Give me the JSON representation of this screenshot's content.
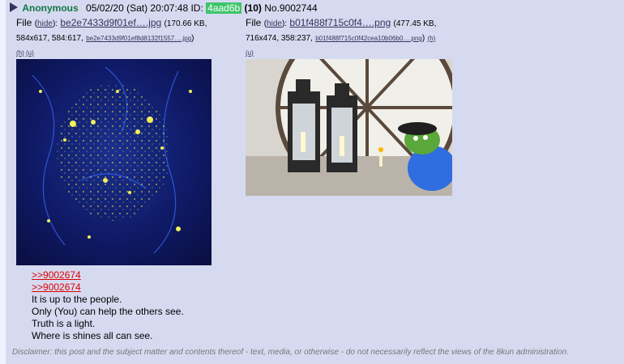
{
  "header": {
    "name": "Anonymous",
    "datetime": "05/02/20 (Sat) 20:07:48",
    "id_label": "ID:",
    "id_value": "4aad6b",
    "reply_count": "(10)",
    "post_number": "No.9002744"
  },
  "files": [
    {
      "prefix": "File",
      "hide_label": "hide",
      "name": "be2e7433d9f01ef….jpg",
      "size": "170.66 KB,",
      "dimensions": "584x617, 584:617,",
      "fullname": "be2e7433d9f01ef8d8132f1557….jpg",
      "h_link": "(h)",
      "u_link": "(u)"
    },
    {
      "prefix": "File",
      "hide_label": "hide",
      "name": "b01f488f715c0f4….png",
      "size": "477.45 KB,",
      "dimensions": "716x474, 358:237,",
      "fullname": "b01f488f715c0f42cea10b06b0….png",
      "h_link": "(h)",
      "u_link": "(u)"
    }
  ],
  "body_lines": {
    "quote1": ">>9002674",
    "quote2": ">>9002674",
    "line1": "It is up to the people.",
    "line2": "Only (You) can help the others see.",
    "line3": "Truth is a light.",
    "line4": "Where is shines all can see."
  },
  "disclaimer": "Disclaimer: this post and the subject matter and contents thereof - text, media, or otherwise - do not necessarily reflect the views of the 8kun administration.",
  "colors": {
    "post_bg": "#d6daf0",
    "name_green": "#117743",
    "id_badge": "#3ec56b",
    "link": "#34345c",
    "quote_red": "#dd0000"
  },
  "icons": {
    "expand": "triangle-right-icon"
  }
}
